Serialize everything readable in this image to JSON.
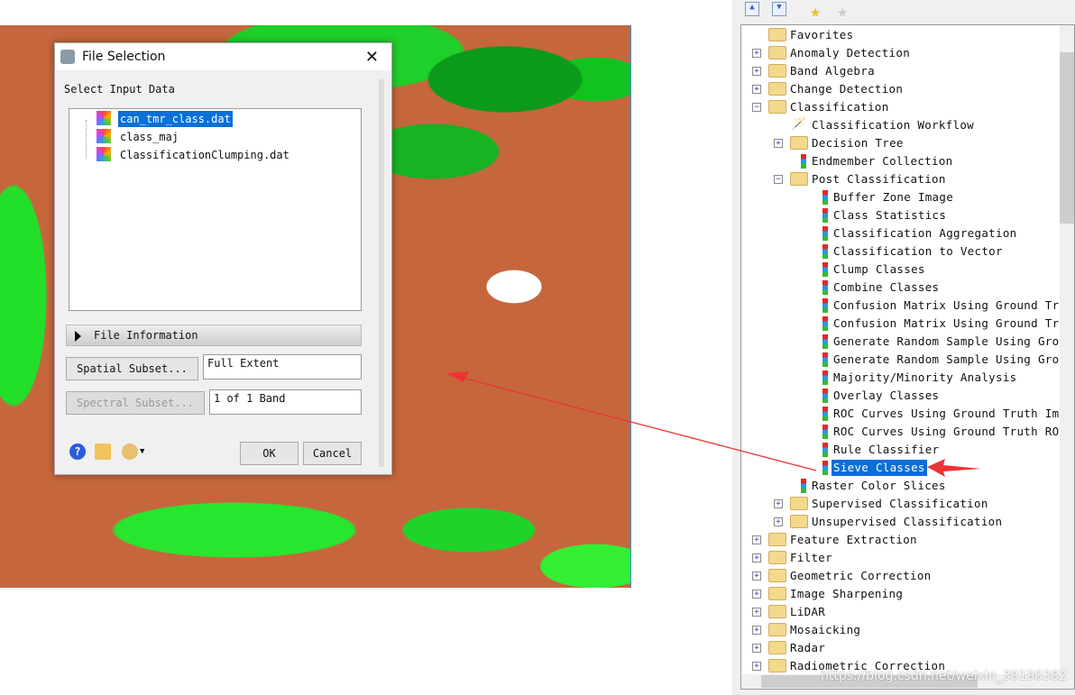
{
  "dialog": {
    "title": "File Selection",
    "select_label": "Select Input Data",
    "files": [
      "can_tmr_class.dat",
      "class_maj",
      "ClassificationClumping.dat"
    ],
    "selected_file": "can_tmr_class.dat",
    "file_info": "File Information",
    "spatial_btn": "Spatial Subset...",
    "spatial_value": "Full Extent",
    "spectral_btn": "Spectral Subset...",
    "spectral_value": "1 of 1 Band",
    "ok": "OK",
    "cancel": "Cancel"
  },
  "toolbox": {
    "items": [
      {
        "label": "Favorites",
        "level": 0,
        "type": "favorites"
      },
      {
        "label": "Anomaly Detection",
        "level": 0,
        "type": "folder",
        "exp": "+"
      },
      {
        "label": "Band Algebra",
        "level": 0,
        "type": "folder",
        "exp": "+"
      },
      {
        "label": "Change Detection",
        "level": 0,
        "type": "folder",
        "exp": "+"
      },
      {
        "label": "Classification",
        "level": 0,
        "type": "folder",
        "exp": "-"
      },
      {
        "label": "Classification Workflow",
        "level": 1,
        "type": "wand"
      },
      {
        "label": "Decision Tree",
        "level": 1,
        "type": "folder",
        "exp": "+"
      },
      {
        "label": "Endmember Collection",
        "level": 1,
        "type": "tool"
      },
      {
        "label": "Post Classification",
        "level": 1,
        "type": "folder",
        "exp": "-"
      },
      {
        "label": "Buffer Zone Image",
        "level": 2,
        "type": "tool"
      },
      {
        "label": "Class Statistics",
        "level": 2,
        "type": "tool"
      },
      {
        "label": "Classification Aggregation",
        "level": 2,
        "type": "tool"
      },
      {
        "label": "Classification to Vector",
        "level": 2,
        "type": "tool"
      },
      {
        "label": "Clump Classes",
        "level": 2,
        "type": "tool"
      },
      {
        "label": "Combine Classes",
        "level": 2,
        "type": "tool"
      },
      {
        "label": "Confusion Matrix Using Ground Trut",
        "level": 2,
        "type": "tool"
      },
      {
        "label": "Confusion Matrix Using Ground Trut",
        "level": 2,
        "type": "tool"
      },
      {
        "label": "Generate Random Sample Using Grour",
        "level": 2,
        "type": "tool"
      },
      {
        "label": "Generate Random Sample Using Grour",
        "level": 2,
        "type": "tool"
      },
      {
        "label": "Majority/Minority Analysis",
        "level": 2,
        "type": "tool"
      },
      {
        "label": "Overlay Classes",
        "level": 2,
        "type": "tool"
      },
      {
        "label": "ROC Curves Using Ground Truth Imag",
        "level": 2,
        "type": "tool"
      },
      {
        "label": "ROC Curves Using Ground Truth ROIs",
        "level": 2,
        "type": "tool"
      },
      {
        "label": "Rule Classifier",
        "level": 2,
        "type": "tool"
      },
      {
        "label": "Sieve Classes",
        "level": 2,
        "type": "tool",
        "selected": true
      },
      {
        "label": "Raster Color Slices",
        "level": 1,
        "type": "tool"
      },
      {
        "label": "Supervised Classification",
        "level": 1,
        "type": "folder",
        "exp": "+"
      },
      {
        "label": "Unsupervised Classification",
        "level": 1,
        "type": "folder",
        "exp": "+"
      },
      {
        "label": "Feature Extraction",
        "level": 0,
        "type": "folder",
        "exp": "+"
      },
      {
        "label": "Filter",
        "level": 0,
        "type": "folder",
        "exp": "+"
      },
      {
        "label": "Geometric Correction",
        "level": 0,
        "type": "folder",
        "exp": "+"
      },
      {
        "label": "Image Sharpening",
        "level": 0,
        "type": "folder",
        "exp": "+"
      },
      {
        "label": "LiDAR",
        "level": 0,
        "type": "folder",
        "exp": "+"
      },
      {
        "label": "Mosaicking",
        "level": 0,
        "type": "folder",
        "exp": "+"
      },
      {
        "label": "Radar",
        "level": 0,
        "type": "folder",
        "exp": "+"
      },
      {
        "label": "Radiometric Correction",
        "level": 0,
        "type": "folder",
        "exp": "+"
      }
    ]
  },
  "annotation_color": "#ee3333",
  "watermark": "https://blog.csdn.net/weixin_39190382"
}
